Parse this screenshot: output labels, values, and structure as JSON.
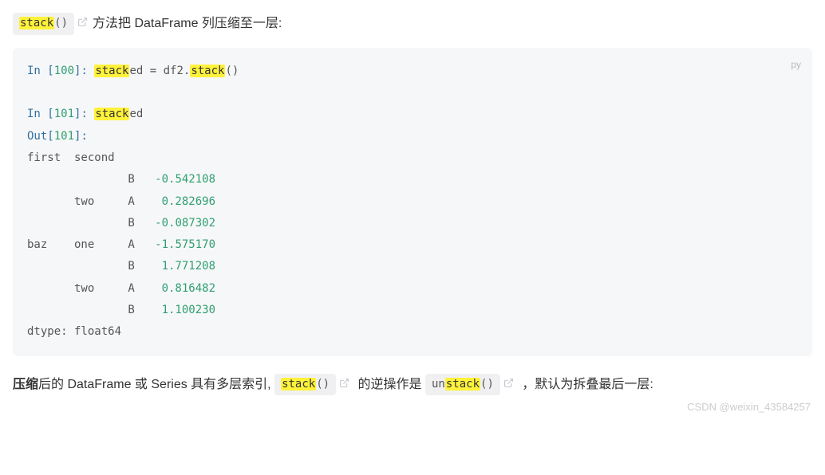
{
  "para1": {
    "code_hl": "stack",
    "code_suffix": "()",
    "text": "方法把 DataFrame 列压缩至一层:"
  },
  "codeblock": {
    "lang": "py",
    "line1_a": "In [",
    "line1_n": "100",
    "line1_b": "]: ",
    "line1_hl": "stack",
    "line1_c": "ed = df2.",
    "line1_hl2": "stack",
    "line1_d": "()",
    "line3_a": "In [",
    "line3_n": "101",
    "line3_b": "]: ",
    "line3_hl": "stack",
    "line3_c": "ed",
    "line4_a": "Out[",
    "line4_n": "101",
    "line4_b": "]:",
    "line5": "first  second",
    "line6_a": "               B   ",
    "line6_n": "-0.542108",
    "line7_a": "       two     A    ",
    "line7_n": "0.282696",
    "line8_a": "               B   ",
    "line8_n": "-0.087302",
    "line9_a": "baz    one     A   ",
    "line9_n": "-1.575170",
    "line10_a": "               B    ",
    "line10_n": "1.771208",
    "line11_a": "       two     A    ",
    "line11_n": "0.816482",
    "line12_a": "               B    ",
    "line12_n": "1.100230",
    "line13": "dtype: float64"
  },
  "para2": {
    "bold": "压缩",
    "t1": "后的 DataFrame 或 Series 具有多层索引, ",
    "code1_hl": "stack",
    "code1_suffix": "()",
    "t2": " 的逆操作是 ",
    "code2_pre": "un",
    "code2_hl": "stack",
    "code2_suffix": "()",
    "t3": " ，默认为拆叠最后一层:"
  },
  "watermark": "CSDN @weixin_43584257"
}
